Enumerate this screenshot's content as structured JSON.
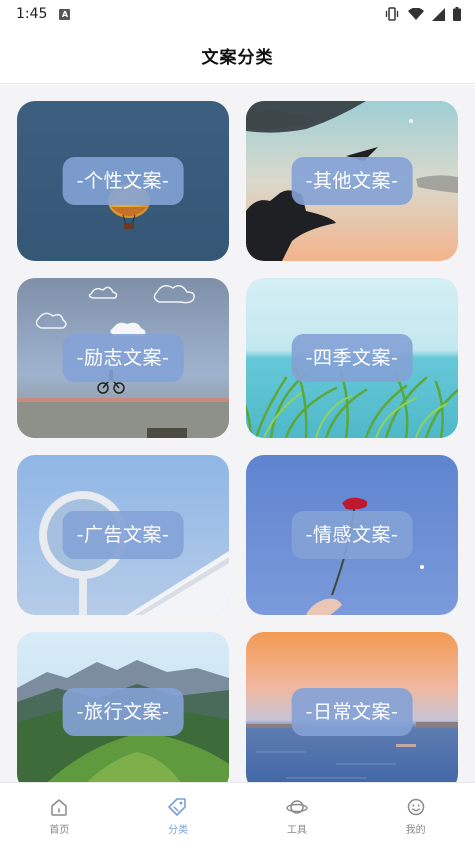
{
  "status_bar": {
    "time": "1:45",
    "app_badge": "A"
  },
  "header": {
    "title": "文案分类"
  },
  "categories": [
    {
      "label": "-个性文案-",
      "theme": "balloon"
    },
    {
      "label": "-其他文案-",
      "theme": "sunset-hand"
    },
    {
      "label": "-励志文案-",
      "theme": "clouds-cyclist"
    },
    {
      "label": "-四季文案-",
      "theme": "grass-sea"
    },
    {
      "label": "-广告文案-",
      "theme": "sky-sign"
    },
    {
      "label": "-情感文案-",
      "theme": "rose-sky"
    },
    {
      "label": "-旅行文案-",
      "theme": "mountains"
    },
    {
      "label": "-日常文案-",
      "theme": "sea-dusk"
    }
  ],
  "tabs": [
    {
      "label": "首页",
      "icon": "home-icon",
      "active": false
    },
    {
      "label": "分类",
      "icon": "tag-icon",
      "active": true
    },
    {
      "label": "工具",
      "icon": "planet-icon",
      "active": false
    },
    {
      "label": "我的",
      "icon": "smile-face-icon",
      "active": false
    }
  ],
  "colors": {
    "accent": "#7aa0dc",
    "label_bg": "#84a2d6",
    "tab_inactive": "#888888"
  }
}
